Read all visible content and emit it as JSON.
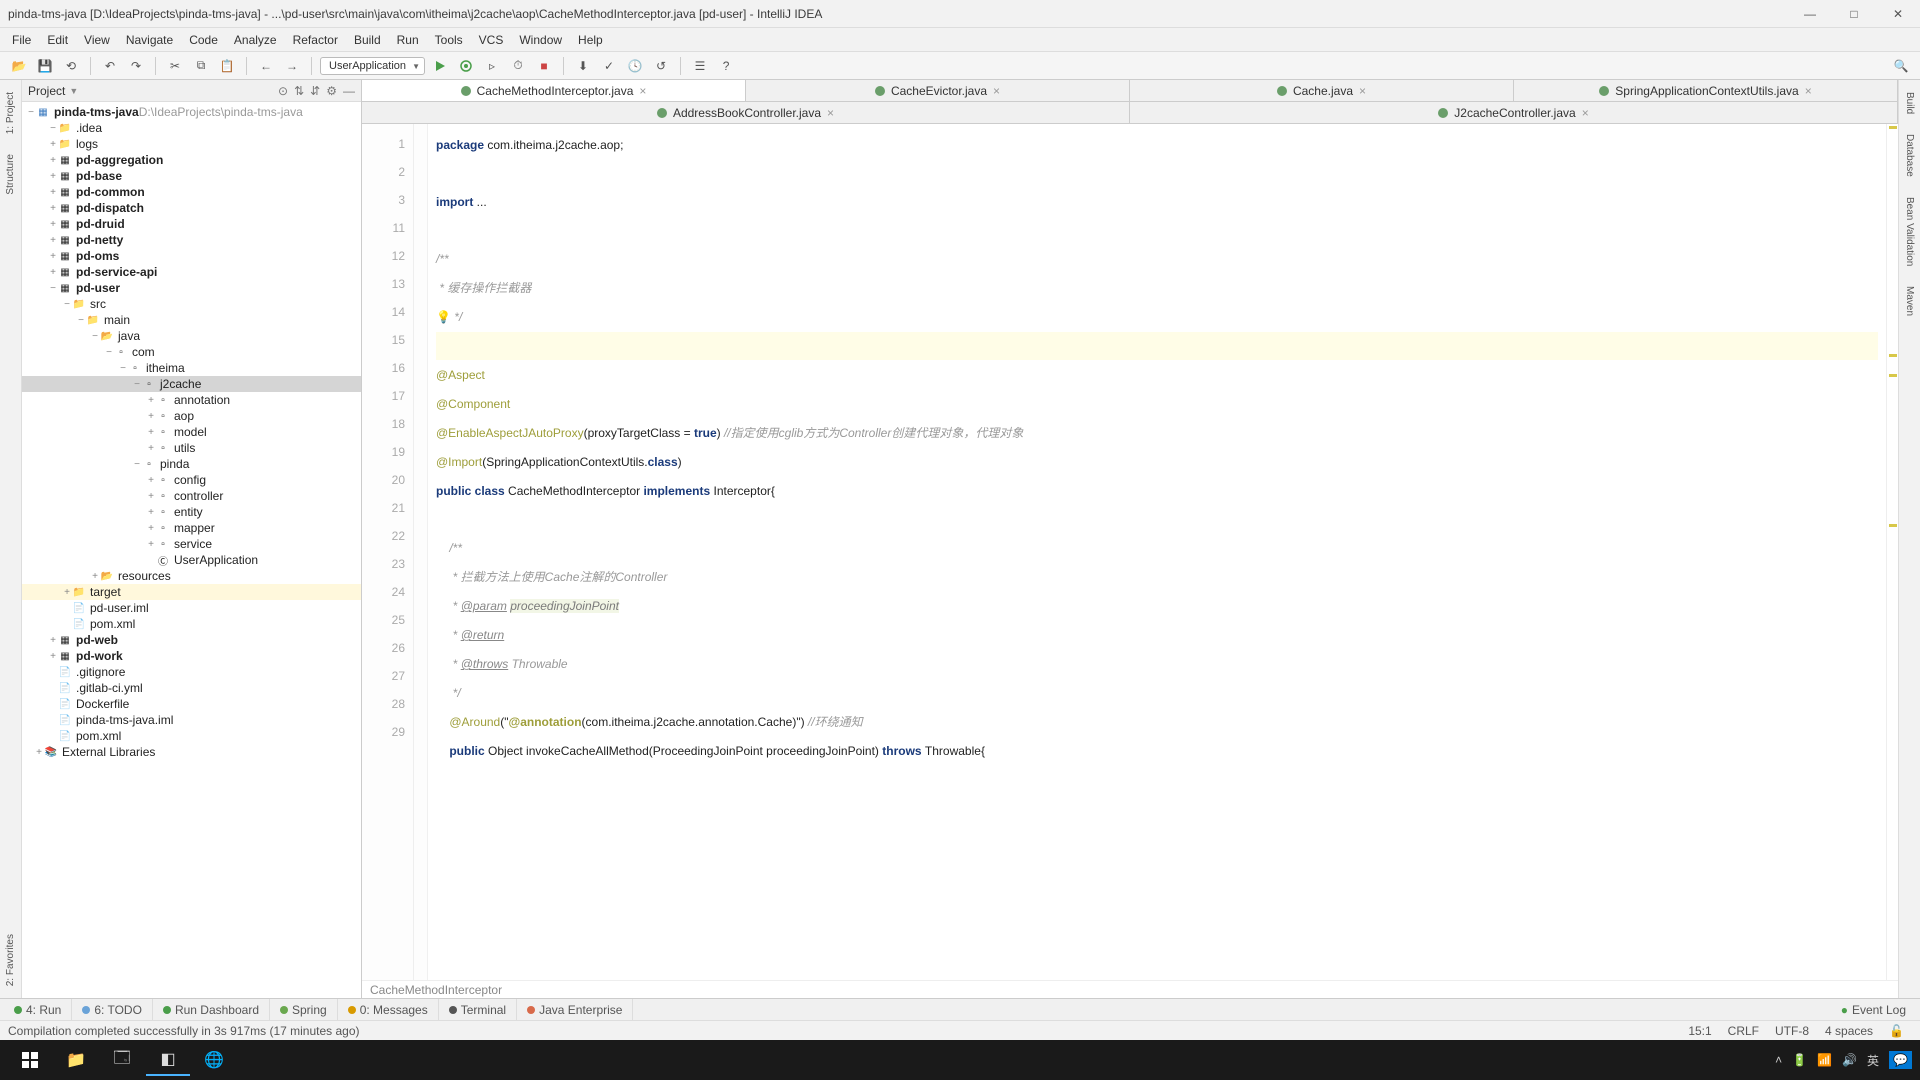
{
  "window": {
    "title": "pinda-tms-java [D:\\IdeaProjects\\pinda-tms-java] - ...\\pd-user\\src\\main\\java\\com\\itheima\\j2cache\\aop\\CacheMethodInterceptor.java [pd-user] - IntelliJ IDEA"
  },
  "menu": [
    "File",
    "Edit",
    "View",
    "Navigate",
    "Code",
    "Analyze",
    "Refactor",
    "Build",
    "Run",
    "Tools",
    "VCS",
    "Window",
    "Help"
  ],
  "toolbar": {
    "run_config": "UserApplication"
  },
  "project_panel": {
    "title": "Project"
  },
  "tree": {
    "root_name": "pinda-tms-java",
    "root_path": "D:\\IdeaProjects\\pinda-tms-java",
    "nodes": [
      {
        "lvl": 1,
        "t": "−",
        "icon": "folder",
        "label": ".idea"
      },
      {
        "lvl": 1,
        "t": "+",
        "icon": "folder",
        "label": "logs"
      },
      {
        "lvl": 1,
        "t": "+",
        "icon": "module",
        "label": "pd-aggregation",
        "bold": true
      },
      {
        "lvl": 1,
        "t": "+",
        "icon": "module",
        "label": "pd-base",
        "bold": true
      },
      {
        "lvl": 1,
        "t": "+",
        "icon": "module",
        "label": "pd-common",
        "bold": true
      },
      {
        "lvl": 1,
        "t": "+",
        "icon": "module",
        "label": "pd-dispatch",
        "bold": true
      },
      {
        "lvl": 1,
        "t": "+",
        "icon": "module",
        "label": "pd-druid",
        "bold": true
      },
      {
        "lvl": 1,
        "t": "+",
        "icon": "module",
        "label": "pd-netty",
        "bold": true
      },
      {
        "lvl": 1,
        "t": "+",
        "icon": "module",
        "label": "pd-oms",
        "bold": true
      },
      {
        "lvl": 1,
        "t": "+",
        "icon": "module",
        "label": "pd-service-api",
        "bold": true
      },
      {
        "lvl": 1,
        "t": "−",
        "icon": "module",
        "label": "pd-user",
        "bold": true
      },
      {
        "lvl": 2,
        "t": "−",
        "icon": "folder",
        "label": "src"
      },
      {
        "lvl": 3,
        "t": "−",
        "icon": "folder",
        "label": "main"
      },
      {
        "lvl": 4,
        "t": "−",
        "icon": "srcfolder",
        "label": "java"
      },
      {
        "lvl": 5,
        "t": "−",
        "icon": "pkg",
        "label": "com"
      },
      {
        "lvl": 6,
        "t": "−",
        "icon": "pkg",
        "label": "itheima"
      },
      {
        "lvl": 7,
        "t": "−",
        "icon": "pkg",
        "label": "j2cache",
        "selected": true
      },
      {
        "lvl": 8,
        "t": "+",
        "icon": "pkg",
        "label": "annotation"
      },
      {
        "lvl": 8,
        "t": "+",
        "icon": "pkg",
        "label": "aop"
      },
      {
        "lvl": 8,
        "t": "+",
        "icon": "pkg",
        "label": "model"
      },
      {
        "lvl": 8,
        "t": "+",
        "icon": "pkg",
        "label": "utils"
      },
      {
        "lvl": 7,
        "t": "−",
        "icon": "pkg",
        "label": "pinda"
      },
      {
        "lvl": 8,
        "t": "+",
        "icon": "pkg",
        "label": "config"
      },
      {
        "lvl": 8,
        "t": "+",
        "icon": "pkg",
        "label": "controller"
      },
      {
        "lvl": 8,
        "t": "+",
        "icon": "pkg",
        "label": "entity"
      },
      {
        "lvl": 8,
        "t": "+",
        "icon": "pkg",
        "label": "mapper"
      },
      {
        "lvl": 8,
        "t": "+",
        "icon": "pkg",
        "label": "service"
      },
      {
        "lvl": 8,
        "t": " ",
        "icon": "java",
        "label": "UserApplication"
      },
      {
        "lvl": 4,
        "t": "+",
        "icon": "resfolder",
        "label": "resources"
      },
      {
        "lvl": 2,
        "t": "+",
        "icon": "folder",
        "label": "target",
        "hl": true
      },
      {
        "lvl": 2,
        "t": " ",
        "icon": "file",
        "label": "pd-user.iml"
      },
      {
        "lvl": 2,
        "t": " ",
        "icon": "file",
        "label": "pom.xml"
      },
      {
        "lvl": 1,
        "t": "+",
        "icon": "module",
        "label": "pd-web",
        "bold": true
      },
      {
        "lvl": 1,
        "t": "+",
        "icon": "module",
        "label": "pd-work",
        "bold": true
      },
      {
        "lvl": 1,
        "t": " ",
        "icon": "file",
        "label": ".gitignore"
      },
      {
        "lvl": 1,
        "t": " ",
        "icon": "file",
        "label": ".gitlab-ci.yml"
      },
      {
        "lvl": 1,
        "t": " ",
        "icon": "file",
        "label": "Dockerfile"
      },
      {
        "lvl": 1,
        "t": " ",
        "icon": "file",
        "label": "pinda-tms-java.iml"
      },
      {
        "lvl": 1,
        "t": " ",
        "icon": "file",
        "label": "pom.xml"
      },
      {
        "lvl": 0,
        "t": "+",
        "icon": "lib",
        "label": "External Libraries"
      }
    ]
  },
  "editor_tabs_row1": [
    {
      "label": "CacheMethodInterceptor.java",
      "active": true
    },
    {
      "label": "CacheEvictor.java"
    },
    {
      "label": "Cache.java"
    },
    {
      "label": "SpringApplicationContextUtils.java"
    }
  ],
  "editor_tabs_row2": [
    {
      "label": "AddressBookController.java"
    },
    {
      "label": "J2cacheController.java"
    }
  ],
  "code": {
    "lines": [
      "1",
      "2",
      "3",
      "11",
      "12",
      "13",
      "14",
      "15",
      "16",
      "17",
      "18",
      "19",
      "20",
      "21",
      "22",
      "23",
      "24",
      "25",
      "26",
      "27",
      "28",
      "29"
    ],
    "l1_kw": "package",
    "l1_rest": " com.itheima.j2cache.aop;",
    "l3_kw": "import",
    "l3_rest": " ...",
    "l12": "/**",
    "l13": " * 缓存操作拦截器",
    "l14": " */",
    "l16": "@Aspect",
    "l17": "@Component",
    "l18_anno": "@EnableAspectJAutoProxy",
    "l18_args": "(proxyTargetClass = ",
    "l18_true": "true",
    "l18_close": ")",
    "l18_cmt": " //指定使用cglib方式为Controller创建代理对象，代理对象",
    "l19_anno": "@Import",
    "l19_open": "(SpringApplicationContextUtils.",
    "l19_cls": "class",
    "l19_close": ")",
    "l20_pub": "public ",
    "l20_cls": "class ",
    "l20_name": "CacheMethodInterceptor ",
    "l20_impl": "implements ",
    "l20_int": "Interceptor{",
    "l22": "    /**",
    "l23": "     * 拦截方法上使用Cache注解的Controller",
    "l24_pre": "     * ",
    "l24_tag": "@param",
    "l24_sp": " ",
    "l24_p": "proceedingJoinPoint",
    "l25_pre": "     * ",
    "l25_tag": "@return",
    "l26_pre": "     * ",
    "l26_tag": "@throws",
    "l26_sp": " ",
    "l26_p": "Throwable",
    "l27": "     */",
    "l28_pre": "    ",
    "l28_anno": "@Around",
    "l28_open": "(\"",
    "l28_bold": "@annotation",
    "l28_rest": "(com.itheima.j2cache.annotation.Cache)\")",
    "l28_cmt": " //环绕通知",
    "l29_pre": "    ",
    "l29_pub": "public ",
    "l29_obj": "Object ",
    "l29_m": "invokeCacheAllMethod(ProceedingJoinPoint proceedingJoinPoint) ",
    "l29_th": "throws ",
    "l29_ex": "Throwable{",
    "breadcrumb": "CacheMethodInterceptor"
  },
  "bottom_tabs": {
    "run": "4: Run",
    "todo": "6: TODO",
    "dash": "Run Dashboard",
    "spring": "Spring",
    "msg": "0: Messages",
    "term": "Terminal",
    "je": "Java Enterprise",
    "eventlog": "Event Log"
  },
  "status": {
    "msg": "Compilation completed successfully in 3s 917ms (17 minutes ago)",
    "pos": "15:1",
    "lf": "CRLF",
    "enc": "UTF-8",
    "spaces": "4 spaces"
  },
  "left_tabs": [
    "1: Project",
    "Structure",
    "2: Favorites"
  ],
  "right_tabs": [
    "Build",
    "Database",
    "Bean Validation",
    "Maven"
  ],
  "taskbar": {
    "time_icons": "^"
  }
}
